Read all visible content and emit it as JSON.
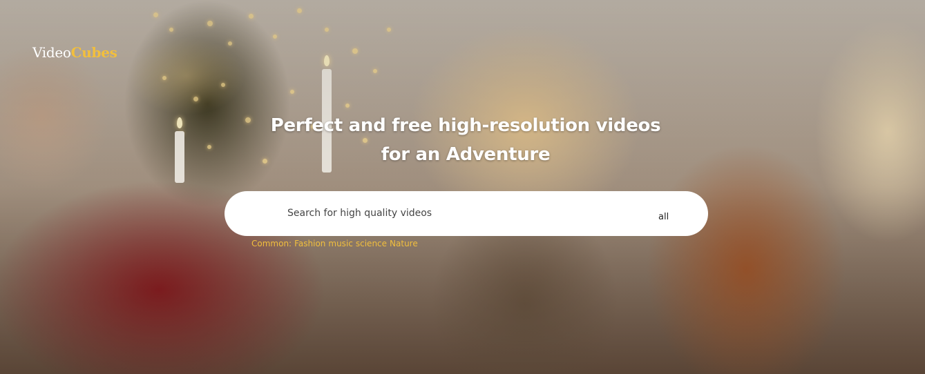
{
  "header": {
    "logo_part1": "Video",
    "logo_part2": "Cubes"
  },
  "hero": {
    "headline_line1": "Perfect and free high-resolution videos",
    "headline_line2": "for an Adventure"
  },
  "search": {
    "placeholder": "Search for high quality videos",
    "value": "",
    "filter_label": "all"
  },
  "common": {
    "label": "Common:",
    "tags": [
      "Fashion",
      "music",
      "science",
      "Nature"
    ]
  },
  "colors": {
    "accent": "#f2bf3d",
    "text_light": "#ffffff",
    "search_bg": "#ffffff"
  }
}
